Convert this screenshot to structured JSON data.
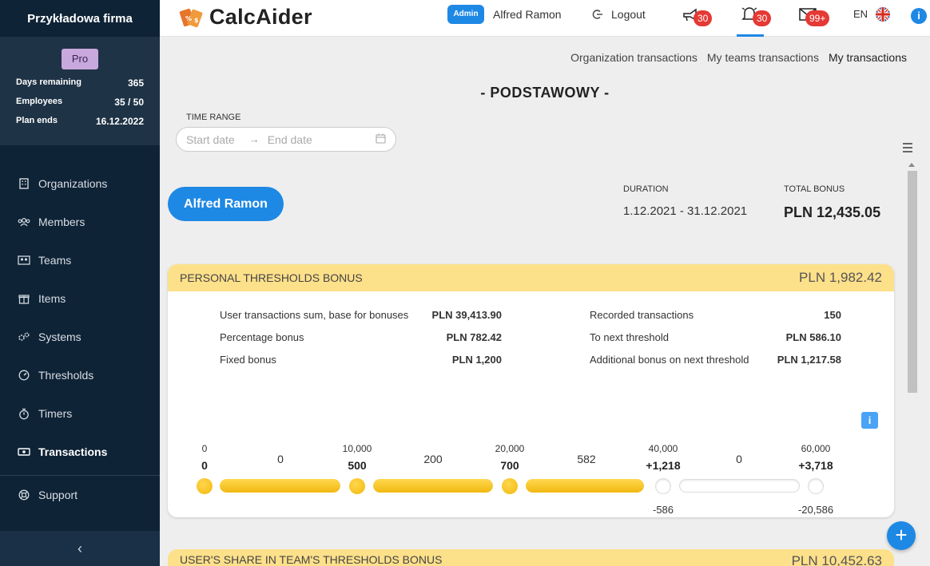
{
  "sidebar": {
    "company": "Przykładowa firma",
    "plan": "Pro",
    "stats": [
      {
        "label": "Days remaining",
        "value": "365"
      },
      {
        "label": "Employees",
        "value": "35 / 50"
      },
      {
        "label": "Plan ends",
        "value": "16.12.2022"
      }
    ],
    "nav": [
      {
        "label": "Organizations",
        "icon": "building-icon"
      },
      {
        "label": "Members",
        "icon": "members-icon"
      },
      {
        "label": "Teams",
        "icon": "teams-icon"
      },
      {
        "label": "Items",
        "icon": "items-icon"
      },
      {
        "label": "Systems",
        "icon": "systems-icon"
      },
      {
        "label": "Thresholds",
        "icon": "gauge-icon"
      },
      {
        "label": "Timers",
        "icon": "stopwatch-icon"
      },
      {
        "label": "Transactions",
        "icon": "money-icon",
        "active": true
      }
    ],
    "support": "Support",
    "collapse": "‹"
  },
  "topbar": {
    "logo_text": "CalcAider",
    "role_badge": "Admin",
    "user_name": "Alfred Ramon",
    "logout": "Logout",
    "megaphone_count": "30",
    "bell_count": "30",
    "mail_count": "99+",
    "language": "EN",
    "info": "i"
  },
  "tabs": {
    "org": "Organization transactions",
    "teams": "My teams transactions",
    "mine": "My transactions"
  },
  "page_title": "- PODSTAWOWY -",
  "time_range": {
    "label": "TIME RANGE",
    "start_placeholder": "Start date",
    "end_placeholder": "End date"
  },
  "user_pill": "Alfred Ramon",
  "summary": {
    "duration_label": "DURATION",
    "duration": "1.12.2021 - 31.12.2021",
    "total_label": "TOTAL BONUS",
    "total": "PLN 12,435.05"
  },
  "personal": {
    "title": "PERSONAL THRESHOLDS BONUS",
    "amount": "PLN 1,982.42",
    "stats_left": [
      {
        "label": "User transactions sum, base for bonuses",
        "value": "PLN 39,413.90"
      },
      {
        "label": "Percentage bonus",
        "value": "PLN 782.42"
      },
      {
        "label": "Fixed bonus",
        "value": "PLN 1,200"
      }
    ],
    "stats_right": [
      {
        "label": "Recorded transactions",
        "value": "150"
      },
      {
        "label": "To next threshold",
        "value": "PLN 586.10"
      },
      {
        "label": "Additional bonus on next threshold",
        "value": "PLN 1,217.58"
      }
    ],
    "thresholds": [
      {
        "value": "0",
        "bonus": "0",
        "reached": true,
        "remaining": ""
      },
      {
        "value": "10,000",
        "bonus": "500",
        "reached": true,
        "remaining": ""
      },
      {
        "value": "20,000",
        "bonus": "700",
        "reached": true,
        "remaining": ""
      },
      {
        "value": "40,000",
        "bonus": "+1,218",
        "reached": false,
        "remaining": "-586"
      },
      {
        "value": "60,000",
        "bonus": "+3,718",
        "reached": false,
        "remaining": "-20,586"
      }
    ],
    "segments": [
      {
        "label": "0",
        "progress": 1.0
      },
      {
        "label": "200",
        "progress": 1.0
      },
      {
        "label": "582",
        "progress": 1.0
      },
      {
        "label": "0",
        "progress": 0.0
      }
    ]
  },
  "team_share": {
    "title": "USER'S SHARE IN TEAM'S THRESHOLDS BONUS",
    "amount": "PLN 10,452.63"
  },
  "fab": "+",
  "colors": {
    "sidebar": "#0f2336",
    "accent": "#1e88e5",
    "card_header": "#fde08a",
    "badge_red": "#e53935",
    "plan_badge": "#c9a8dd"
  }
}
